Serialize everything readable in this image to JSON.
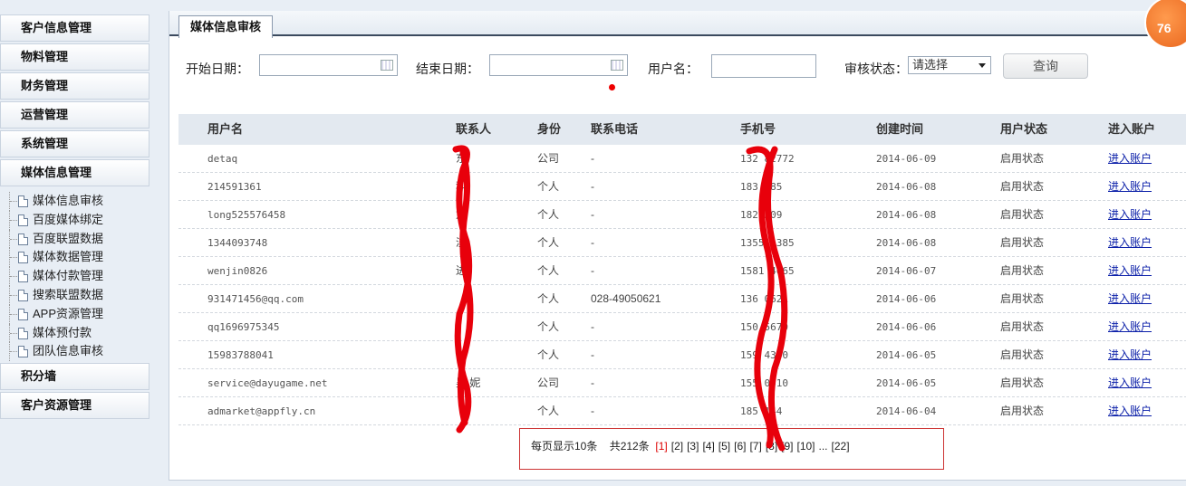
{
  "sidebar": {
    "cats_top": [
      "客户信息管理",
      "物料管理",
      "财务管理",
      "运营管理",
      "系统管理",
      "媒体信息管理"
    ],
    "sub_items": [
      "媒体信息审核",
      "百度媒体绑定",
      "百度联盟数据",
      "媒体数据管理",
      "媒体付款管理",
      "搜索联盟数据",
      "APP资源管理",
      "媒体预付款",
      "团队信息审核"
    ],
    "cats_bottom": [
      "积分墙",
      "客户资源管理"
    ]
  },
  "tab": {
    "label": "媒体信息审核"
  },
  "filter": {
    "start_label": "开始日期：",
    "end_label": "结束日期：",
    "user_label": "用户名：",
    "status_label": "审核状态：",
    "status_value": "请选择",
    "query_label": "查询"
  },
  "table": {
    "headers": [
      "用户名",
      "联系人",
      "身份",
      "联系电话",
      "手机号",
      "创建时间",
      "用户状态",
      "进入账户"
    ],
    "rows": [
      {
        "user": "detaq",
        "contact": "东",
        "identity": "公司",
        "phone": "-",
        "mobile": "132  82772",
        "created": "2014-06-09",
        "status": "启用状态",
        "enter": "进入账户"
      },
      {
        "user": "214591361",
        "contact": "科",
        "identity": "个人",
        "phone": "-",
        "mobile": "183    385",
        "created": "2014-06-08",
        "status": "启用状态",
        "enter": "进入账户"
      },
      {
        "user": "long525576458",
        "contact": "龙",
        "identity": "个人",
        "phone": "-",
        "mobile": "182    309",
        "created": "2014-06-08",
        "status": "启用状态",
        "enter": "进入账户"
      },
      {
        "user": "1344093748",
        "contact": "淡",
        "identity": "个人",
        "phone": "-",
        "mobile": "1355  4385",
        "created": "2014-06-08",
        "status": "启用状态",
        "enter": "进入账户"
      },
      {
        "user": "wenjin0826",
        "contact": "进",
        "identity": "个人",
        "phone": "-",
        "mobile": "1581  4065",
        "created": "2014-06-07",
        "status": "启用状态",
        "enter": "进入账户"
      },
      {
        "user": "931471456@qq.com",
        "contact": "",
        "identity": "个人",
        "phone": "028-49050621",
        "mobile": "136   0621",
        "created": "2014-06-06",
        "status": "启用状态",
        "enter": "进入账户"
      },
      {
        "user": "qq1696975345",
        "contact": "",
        "identity": "个人",
        "phone": "-",
        "mobile": "150   5670",
        "created": "2014-06-06",
        "status": "启用状态",
        "enter": "进入账户"
      },
      {
        "user": "15983788041",
        "contact": "",
        "identity": "个人",
        "phone": "-",
        "mobile": "159   4360",
        "created": "2014-06-05",
        "status": "启用状态",
        "enter": "进入账户"
      },
      {
        "user": "service@dayugame.net",
        "contact": "吴 妮",
        "identity": "公司",
        "phone": "-",
        "mobile": "155   0510",
        "created": "2014-06-05",
        "status": "启用状态",
        "enter": "进入账户"
      },
      {
        "user": "admarket@appfly.cn",
        "contact": "",
        "identity": "个人",
        "phone": "-",
        "mobile": "185   144",
        "created": "2014-06-04",
        "status": "启用状态",
        "enter": "进入账户"
      }
    ]
  },
  "pager": {
    "per_page": "每页显示10条",
    "total": "共212条",
    "pages": [
      "[1]",
      "[2]",
      "[3]",
      "[4]",
      "[5]",
      "[6]",
      "[7]",
      "[8]",
      "[9]",
      "[10]",
      "...",
      "[22]"
    ]
  },
  "badge": {
    "text": "76"
  }
}
